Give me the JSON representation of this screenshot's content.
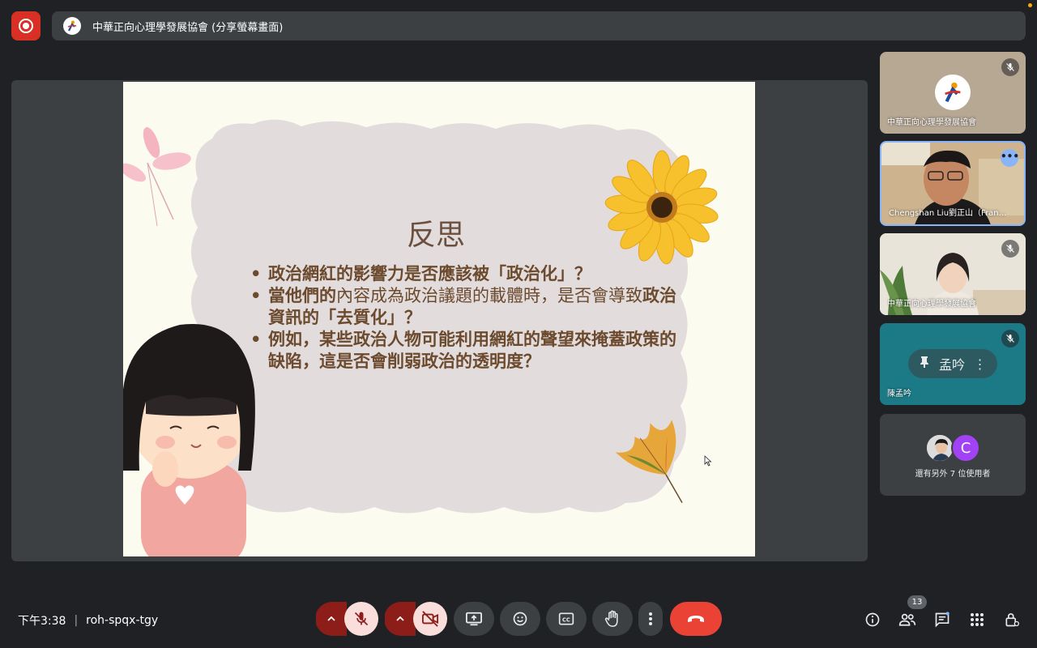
{
  "header": {
    "presenter_title": "中華正向心理學發展協會 (分享螢幕畫面)"
  },
  "slide": {
    "title": "反思",
    "bullets": [
      {
        "bold": "政治網紅的影響力是否應該被「政治化」？",
        "light": ""
      },
      {
        "bold": "當他們的",
        "light": "內容成為政治議題的載體時，是否會導致",
        "bold2": "政治資訊的「去質化」？"
      },
      {
        "bold": "例如，某些政治人物可能利用網紅的聲望來掩蓋政策的缺陷，這是否會削弱政治的透明度？",
        "light": ""
      }
    ]
  },
  "participants": [
    {
      "name": "中華正向心理學發展協會",
      "muted": true
    },
    {
      "name": "Chengshan Liu劉正山（Fran...",
      "muted": false,
      "active_speaker": true
    },
    {
      "name": "中華正向心理學發展協會",
      "muted": true
    },
    {
      "name": "陳孟吟",
      "muted": true,
      "overlay_label": "孟吟"
    },
    {
      "others_text": "還有另外 7 位使用者",
      "avatar_letter": "C"
    }
  ],
  "footer": {
    "time": "下午3:38",
    "meeting_code": "roh-spqx-tgy",
    "participant_count": "13"
  },
  "colors": {
    "record_red": "#d93025",
    "leave_red": "#ea4335",
    "muted_pink": "#f9dedc",
    "accent_blue": "#8ab4f8"
  },
  "icons": [
    "record-icon",
    "mic-off-icon",
    "camera-off-icon",
    "present-icon",
    "emoji-icon",
    "captions-icon",
    "raise-hand-icon",
    "more-options-icon",
    "end-call-icon",
    "info-icon",
    "people-icon",
    "chat-icon",
    "activities-icon",
    "host-controls-icon",
    "pin-icon"
  ]
}
